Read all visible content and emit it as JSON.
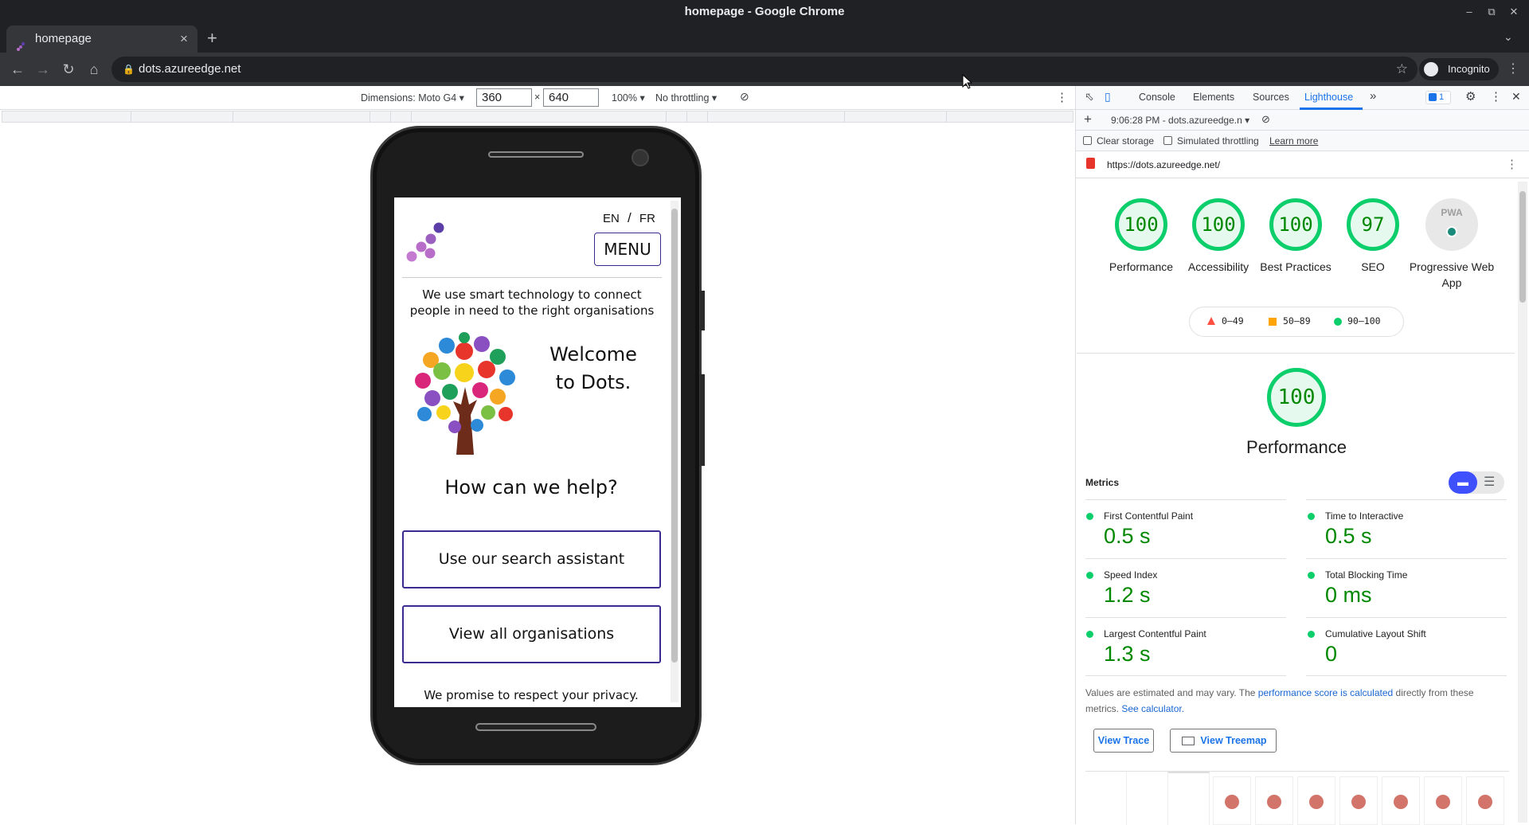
{
  "window": {
    "title": "homepage - Google Chrome"
  },
  "tab": {
    "title": "homepage",
    "close": "×",
    "new_tab": "+"
  },
  "toolbar": {
    "url": "dots.azureedge.net",
    "incognito": "Incognito"
  },
  "device_toolbar": {
    "dimensions_label": "Dimensions: Moto G4",
    "width": "360",
    "times": "×",
    "height": "640",
    "zoom": "100%",
    "throttling": "No throttling"
  },
  "site": {
    "lang_en": "EN",
    "lang_sep": "/",
    "lang_fr": "FR",
    "menu": "MENU",
    "tagline": "We use smart technology to connect people in need to the right organisations",
    "welcome": "Welcome to Dots.",
    "help_heading": "How can we help?",
    "search_button": "Use our search assistant",
    "orgs_button": "View all organisations",
    "privacy": "We promise to respect your privacy."
  },
  "devtools": {
    "tabs": [
      "Console",
      "Elements",
      "Sources",
      "Lighthouse"
    ],
    "active_tab": "Lighthouse",
    "more": "»",
    "issues_count": "1",
    "report_select": "9:06:28 PM - dots.azureedge.n",
    "clear_storage": "Clear storage",
    "simulated_throttling": "Simulated throttling",
    "learn_more": "Learn more",
    "report_url": "https://dots.azureedge.net/"
  },
  "lighthouse": {
    "scores": [
      {
        "label": "Performance",
        "value": "100"
      },
      {
        "label": "Accessibility",
        "value": "100"
      },
      {
        "label": "Best Practices",
        "value": "100"
      },
      {
        "label": "SEO",
        "value": "97"
      }
    ],
    "pwa_label": "Progressive Web App",
    "pwa_badge": "PWA",
    "legend": [
      "0–49",
      "50–89",
      "90–100"
    ],
    "main_score": "100",
    "main_label": "Performance",
    "metrics_title": "Metrics",
    "metrics": [
      {
        "name": "First Contentful Paint",
        "value": "0.5 s"
      },
      {
        "name": "Time to Interactive",
        "value": "0.5 s"
      },
      {
        "name": "Speed Index",
        "value": "1.2 s"
      },
      {
        "name": "Total Blocking Time",
        "value": "0 ms"
      },
      {
        "name": "Largest Contentful Paint",
        "value": "1.3 s"
      },
      {
        "name": "Cumulative Layout Shift",
        "value": "0"
      }
    ],
    "note_prefix": "Values are estimated and may vary. The ",
    "note_link": "performance score is calculated",
    "note_mid": " directly from these metrics. ",
    "note_link2": "See calculator.",
    "view_trace": "View Trace",
    "view_treemap": "View Treemap"
  },
  "colors": {
    "pass": "#0cce6b",
    "pass_text": "#008800",
    "brand": "#3b2a8f",
    "fail": "#ff4e42",
    "average": "#ffa400"
  }
}
